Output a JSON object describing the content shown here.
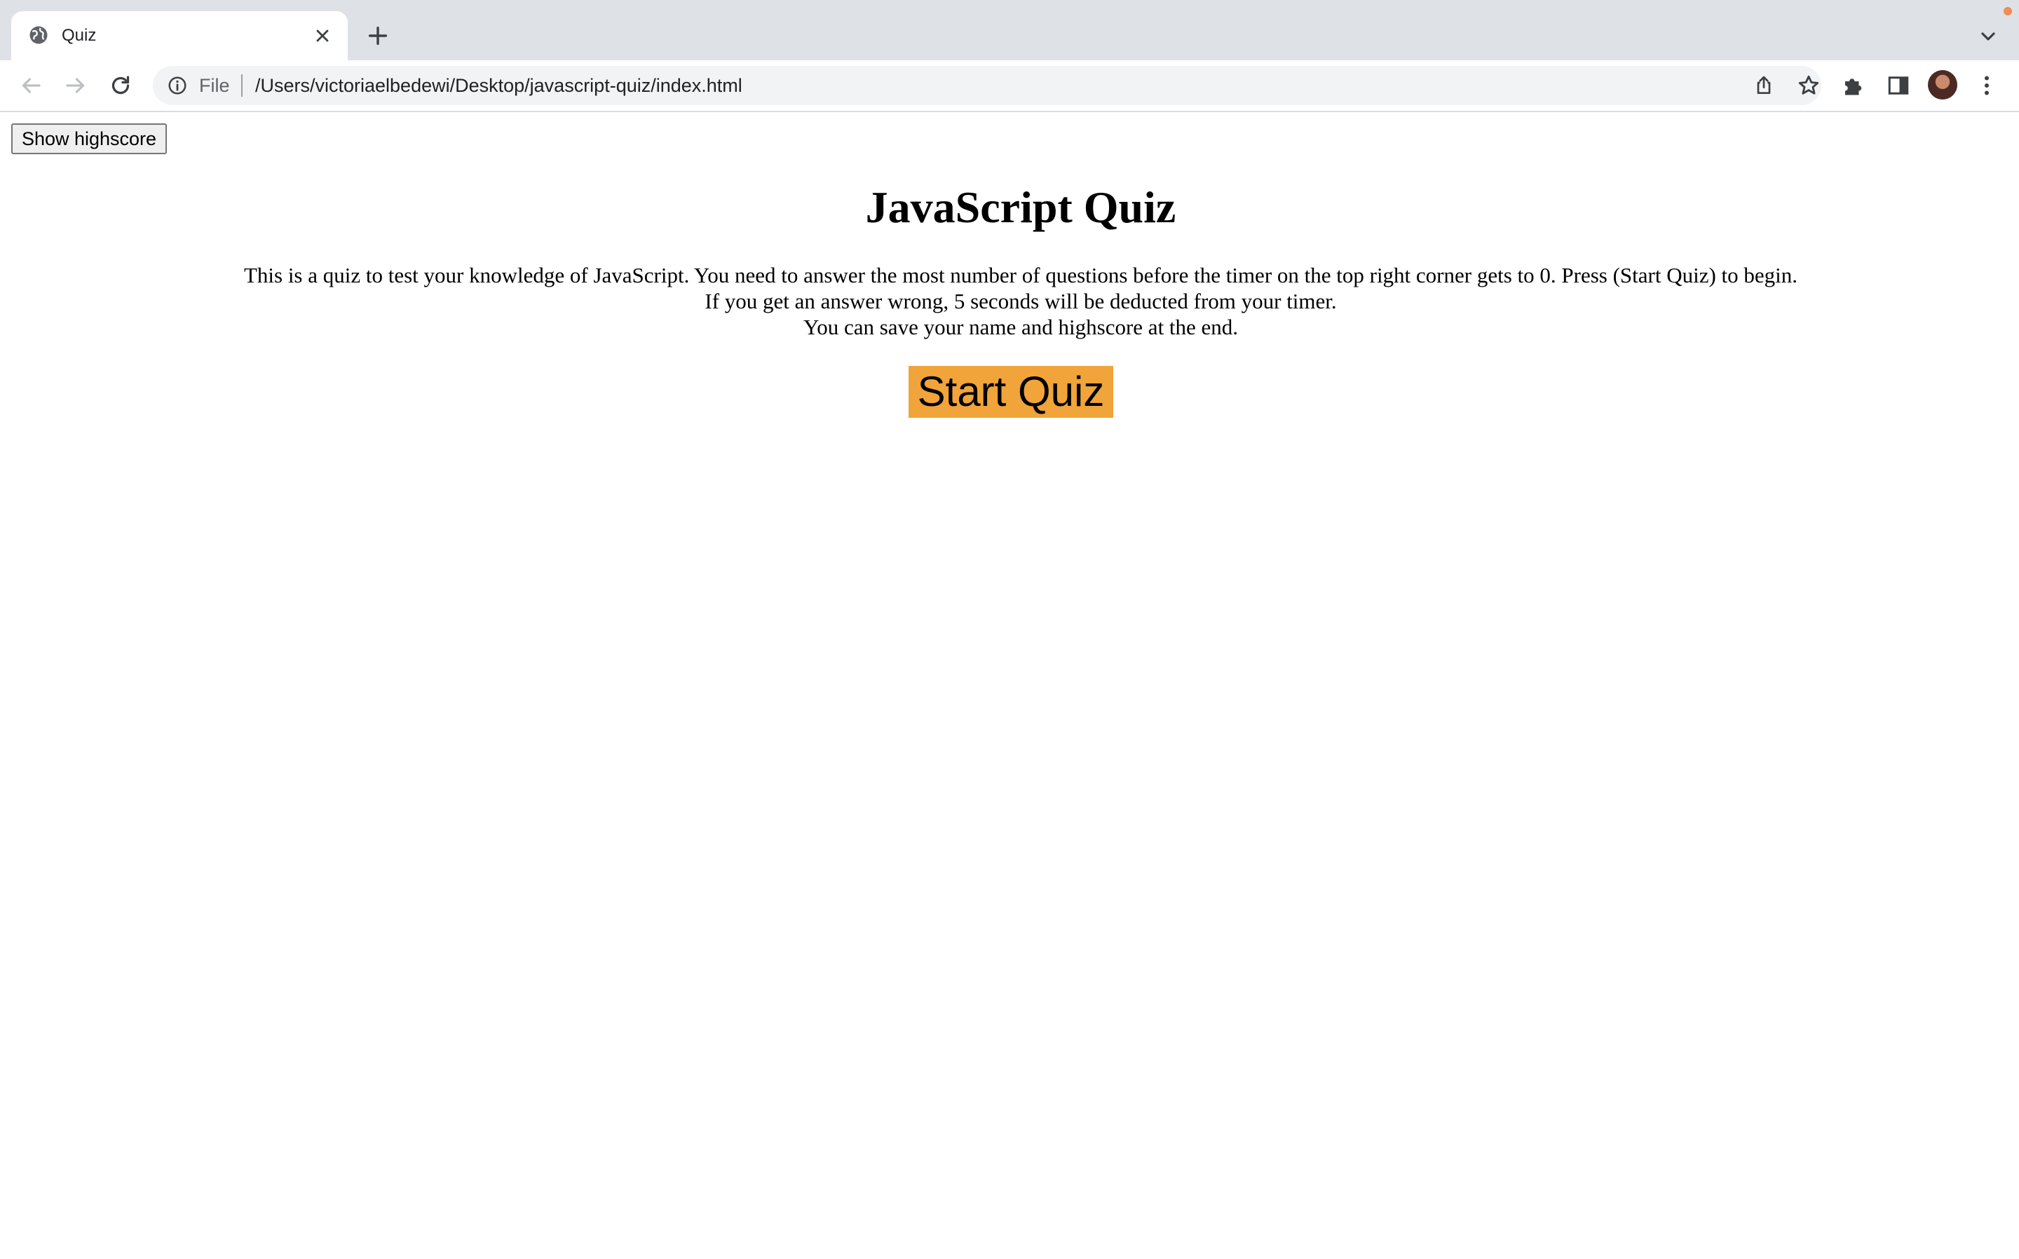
{
  "browser": {
    "tab": {
      "title": "Quiz",
      "favicon": "globe-icon"
    },
    "address_bar": {
      "scheme_label": "File",
      "url": "/Users/victoriaelbedewi/Desktop/javascript-quiz/index.html"
    },
    "icons": {
      "back": "arrow-left-icon",
      "forward": "arrow-right-icon",
      "reload": "reload-icon",
      "info": "info-icon",
      "share": "share-icon",
      "bookmark": "star-icon",
      "extensions": "puzzle-icon",
      "side_panel": "side-panel-icon",
      "menu": "kebab-menu-icon",
      "new_tab": "plus-icon",
      "tab_close": "close-icon",
      "tab_list": "chevron-down-icon"
    },
    "colors": {
      "tabstrip": "#dee1e6",
      "omnibox": "#f1f3f4",
      "notification_dot": "#f28b54"
    }
  },
  "page": {
    "highscore_button": "Show highscore",
    "title": "JavaScript Quiz",
    "instructions": [
      "This is a quiz to test your knowledge of JavaScript. You need to answer the most number of questions before the timer on the top right corner gets to 0. Press (Start Quiz) to begin.",
      "If you get an answer wrong, 5 seconds will be deducted from your timer.",
      "You can save your name and highscore at the end."
    ],
    "start_button": "Start Quiz",
    "colors": {
      "start_button": "#f0a43a"
    }
  }
}
